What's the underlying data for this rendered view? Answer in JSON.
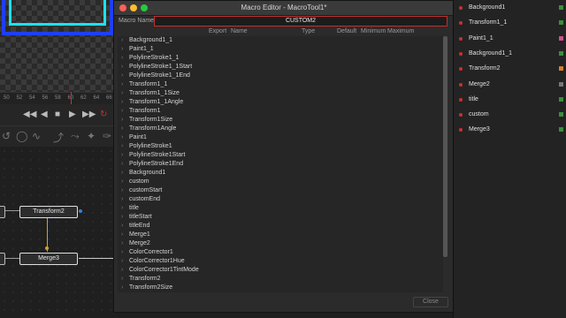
{
  "viewer": {
    "ruler_ticks": [
      "50",
      "52",
      "54",
      "56",
      "58",
      "60",
      "62",
      "64",
      "66"
    ]
  },
  "transport": {
    "icons": [
      "skip-back-icon",
      "play-reverse-icon",
      "stop-icon",
      "play-icon",
      "skip-forward-icon",
      "loop-icon"
    ]
  },
  "node_graph": {
    "nodes": [
      "Transform2",
      "Merge3"
    ]
  },
  "dialog": {
    "title": "Macro Editor - MacroTool1*",
    "macro_name_label": "Macro Name",
    "macro_name_value": "CUSTOM2",
    "columns": [
      "Export",
      "Name",
      "Type",
      "Default",
      "Minimum",
      "Maximum"
    ],
    "rows": [
      "Background1_1",
      "Paint1_1",
      "PolylineStroke1_1",
      "PolylineStroke1_1Start",
      "PolylineStroke1_1End",
      "Transform1_1",
      "Transform1_1Size",
      "Transform1_1Angle",
      "Transform1",
      "Transform1Size",
      "Transform1Angle",
      "Paint1",
      "PolylineStroke1",
      "PolylineStroke1Start",
      "PolylineStroke1End",
      "Background1",
      "custom",
      "customStart",
      "customEnd",
      "title",
      "titleStart",
      "titleEnd",
      "Merge1",
      "Merge2",
      "ColorCorrector1",
      "ColorCorrector1Hue",
      "ColorCorrector1TintMode",
      "Transform2",
      "Transform2Size"
    ],
    "close_label": "Close"
  },
  "right_panel": {
    "items": [
      {
        "label": "Background1",
        "color": "#3a8f3a"
      },
      {
        "label": "Transform1_1",
        "color": "#3a8f3a"
      },
      {
        "label": "Paint1_1",
        "color": "#d0508a"
      },
      {
        "label": "Background1_1",
        "color": "#3a8f3a"
      },
      {
        "label": "Transform2",
        "color": "#d08030"
      },
      {
        "label": "Merge2",
        "color": "#777777"
      },
      {
        "label": "title",
        "color": "#3a8f3a"
      },
      {
        "label": "custom",
        "color": "#3a8f3a"
      },
      {
        "label": "Merge3",
        "color": "#3a8f3a"
      }
    ]
  }
}
